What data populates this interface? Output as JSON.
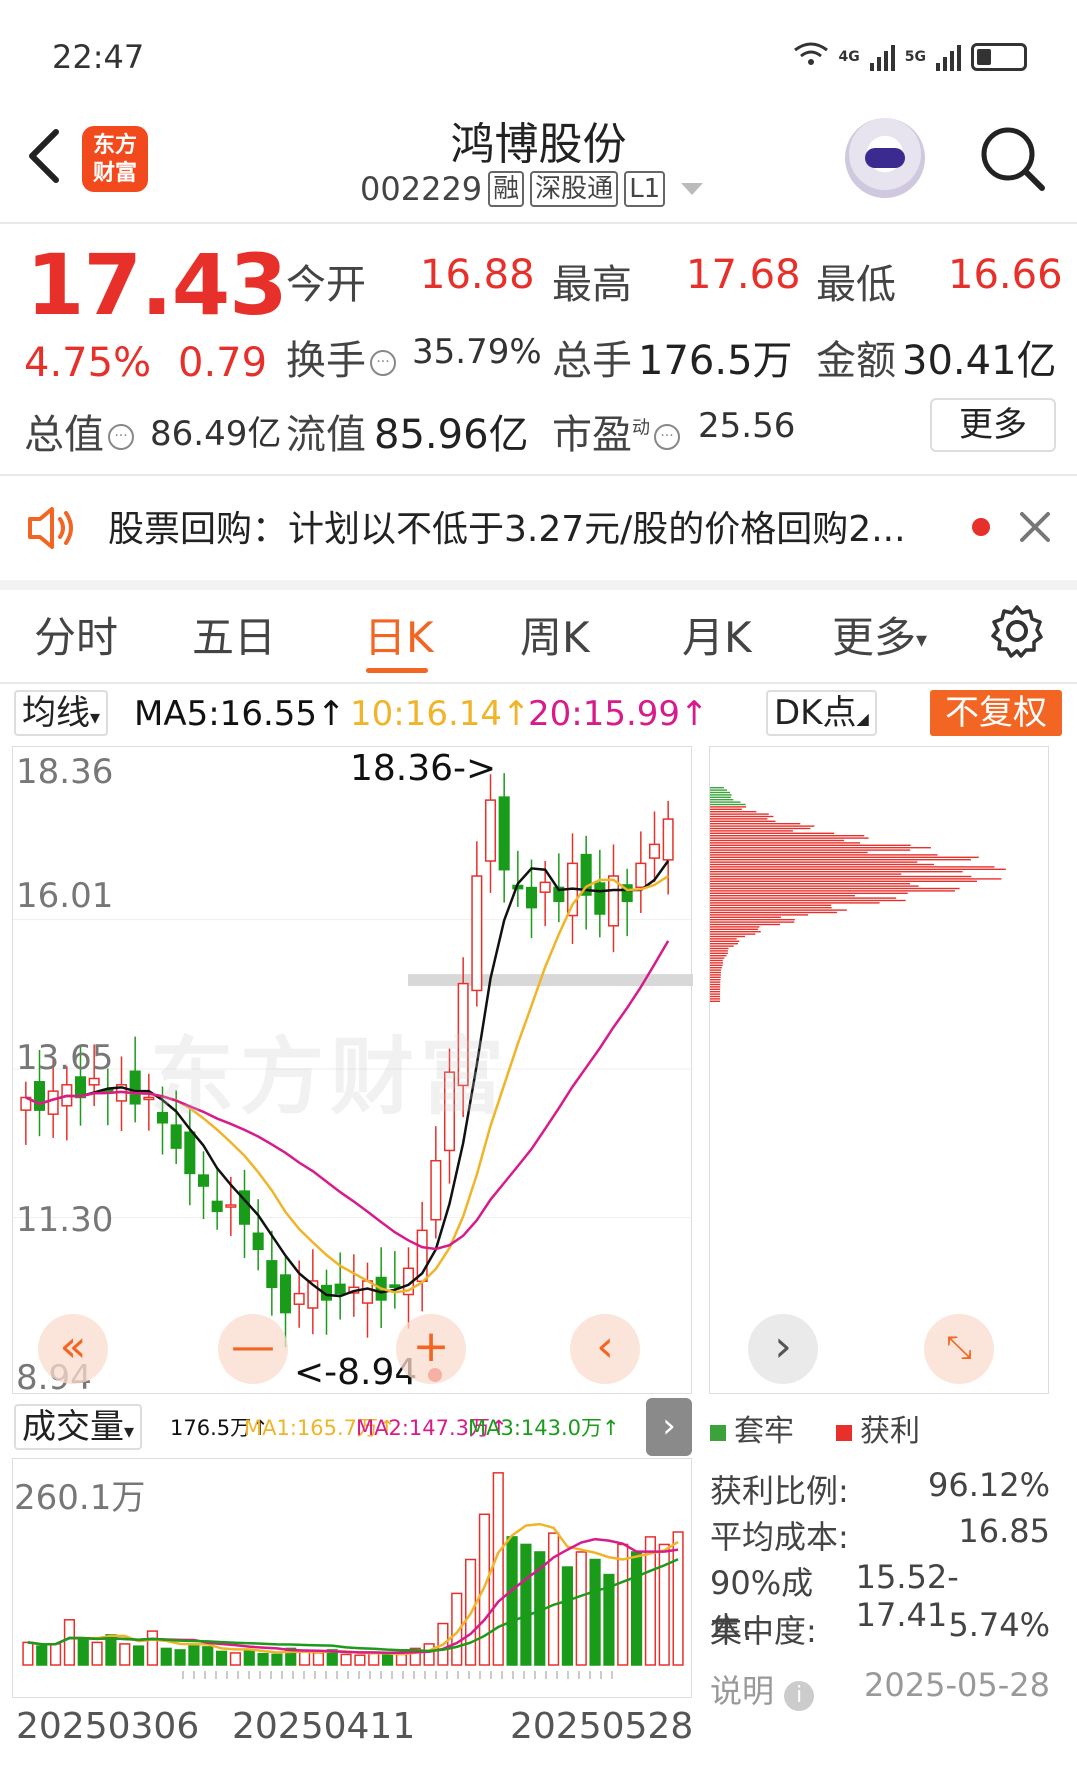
{
  "status_bar": {
    "time": "22:47",
    "net1": "4G",
    "net2": "5G"
  },
  "header": {
    "logo_line1": "东方",
    "logo_line2": "财富",
    "stock_name": "鸿博股份",
    "stock_code": "002229",
    "tag_rong": "融",
    "tag_connect": "深股通",
    "tag_level": "L1"
  },
  "quote": {
    "price": "17.43",
    "change_pct": "4.75%",
    "change_amt": "0.79",
    "open_label": "今开",
    "open": "16.88",
    "high_label": "最高",
    "high": "17.68",
    "low_label": "最低",
    "low": "16.66",
    "turnover_label": "换手",
    "turnover": "35.79%",
    "volume_label": "总手",
    "volume": "176.5万",
    "amount_label": "金额",
    "amount": "30.41亿",
    "mktcap_label": "总值",
    "mktcap": "86.49亿",
    "float_label": "流值",
    "float_cap": "85.96亿",
    "pe_label": "市盈",
    "pe_sup": "动",
    "pe": "25.56",
    "more_button": "更多"
  },
  "notice": {
    "text": "股票回购：计划以不低于3.27元/股的价格回购2..."
  },
  "tabs": [
    "分时",
    "五日",
    "日K",
    "周K",
    "月K",
    "更多"
  ],
  "active_tab": "日K",
  "ma_bar": {
    "select": "均线",
    "ma5": "MA5:16.55↑",
    "ma10": "10:16.14↑",
    "ma20": "20:15.99↑",
    "dk_select": "DK点",
    "fq_button": "不复权"
  },
  "kline": {
    "y_labels": [
      "18.36",
      "16.01",
      "13.65",
      "11.30",
      "8.94"
    ],
    "max_marker": "18.36->",
    "min_marker": "<-8.94",
    "watermark": "东方财富"
  },
  "volume_bar": {
    "select": "成交量",
    "vol": "176.5万↑",
    "ma1": "MA1:165.7万↑",
    "ma2": "MA2:147.3万↑",
    "ma3": "MA3:143.0万↑",
    "y_label": "260.1万"
  },
  "x_labels": [
    "20250306",
    "20250411",
    "20250528"
  ],
  "distribution": {
    "legend_trapped": "套牢",
    "legend_profit": "获利",
    "rows": [
      {
        "label": "获利比例:",
        "value": "96.12%"
      },
      {
        "label": "平均成本:",
        "value": "16.85"
      },
      {
        "label": "90%成本:",
        "value": "15.52-17.41"
      },
      {
        "label": "集中度:",
        "value": "5.74%"
      }
    ],
    "note_label": "说明",
    "date": "2025-05-28"
  },
  "colors": {
    "up": "#e8302a",
    "down": "#1a9b1a",
    "accent": "#f26522",
    "ma5": "#111111",
    "ma10": "#f0b429",
    "ma20": "#d81b8a"
  }
}
